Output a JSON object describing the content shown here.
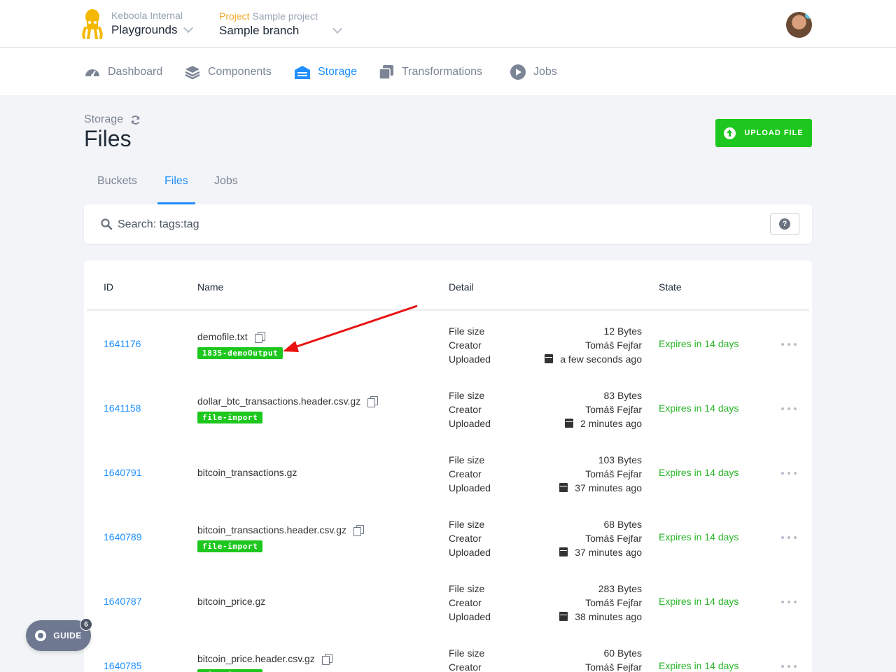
{
  "org": {
    "label": "Keboola Internal",
    "name": "Playgrounds"
  },
  "project": {
    "label_prefix": "Project",
    "name": "Sample project",
    "branch": "Sample branch"
  },
  "nav": [
    {
      "label": "Dashboard",
      "icon": "dashboard-icon"
    },
    {
      "label": "Components",
      "icon": "layers-icon"
    },
    {
      "label": "Storage",
      "icon": "warehouse-icon"
    },
    {
      "label": "Transformations",
      "icon": "copy-stack-icon"
    },
    {
      "label": "Jobs",
      "icon": "play-circle-icon"
    }
  ],
  "header": {
    "breadcrumb": "Storage",
    "title": "Files",
    "upload_label": "UPLOAD FILE"
  },
  "tabs": [
    "Buckets",
    "Files",
    "Jobs"
  ],
  "search": {
    "placeholder": "Search: tags:tag"
  },
  "table": {
    "headers": {
      "id": "ID",
      "name": "Name",
      "detail": "Detail",
      "state": "State"
    },
    "detail_labels": {
      "size": "File size",
      "creator": "Creator",
      "uploaded": "Uploaded"
    },
    "rows": [
      {
        "id": "1641176",
        "name": "demofile.txt",
        "tag": "1835-demoOutput",
        "size": "12 Bytes",
        "creator": "Tomáš Fejfar",
        "uploaded": "a few seconds ago",
        "state": "Expires in 14 days"
      },
      {
        "id": "1641158",
        "name": "dollar_btc_transactions.header.csv.gz",
        "tag": "file-import",
        "size": "83 Bytes",
        "creator": "Tomáš Fejfar",
        "uploaded": "2 minutes ago",
        "state": "Expires in 14 days"
      },
      {
        "id": "1640791",
        "name": "bitcoin_transactions.gz",
        "tag": "",
        "size": "103 Bytes",
        "creator": "Tomáš Fejfar",
        "uploaded": "37 minutes ago",
        "state": "Expires in 14 days"
      },
      {
        "id": "1640789",
        "name": "bitcoin_transactions.header.csv.gz",
        "tag": "file-import",
        "size": "68 Bytes",
        "creator": "Tomáš Fejfar",
        "uploaded": "37 minutes ago",
        "state": "Expires in 14 days"
      },
      {
        "id": "1640787",
        "name": "bitcoin_price.gz",
        "tag": "",
        "size": "283 Bytes",
        "creator": "Tomáš Fejfar",
        "uploaded": "38 minutes ago",
        "state": "Expires in 14 days"
      },
      {
        "id": "1640785",
        "name": "bitcoin_price.header.csv.gz",
        "tag": "file-import",
        "size": "60 Bytes",
        "creator": "Tomáš Fejfar",
        "uploaded": "",
        "state": "Expires in 14 days"
      }
    ]
  },
  "guide": {
    "label": "GUIDE",
    "count": "6"
  },
  "colors": {
    "accent": "#1f8fff",
    "success": "#1ec71e",
    "brand": "#f5b800",
    "annotation": "#e8110f"
  }
}
